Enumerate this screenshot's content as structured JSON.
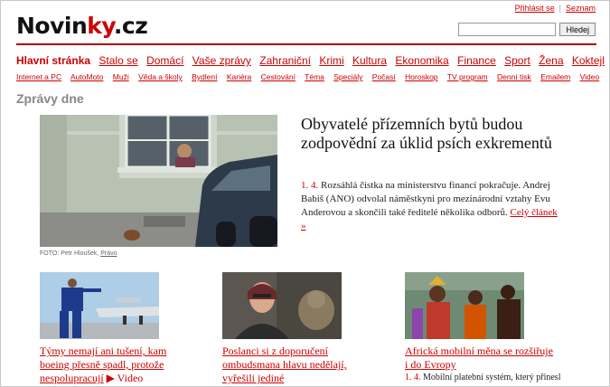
{
  "header": {
    "logo_main": "Novin",
    "logo_accent": "ky",
    "logo_tld": ".cz",
    "login_link": "Přihlásit se",
    "list_link": "Seznam",
    "search_placeholder": "",
    "search_button": "Hledej"
  },
  "nav_primary": [
    "Hlavní stránka",
    "Stalo se",
    "Domácí",
    "Vaše zprávy",
    "Zahraniční",
    "Krimi",
    "Kultura",
    "Ekonomika",
    "Finance",
    "Sport",
    "Žena",
    "Koktejl"
  ],
  "nav_secondary": [
    "Internet a PC",
    "AutoMoto",
    "Muži",
    "Věda a školy",
    "Bydlení",
    "Kariéra",
    "Cestování",
    "Téma",
    "Speciály",
    "Počasí",
    "Horoskop",
    "TV program",
    "Denní tisk",
    "Emailem",
    "Video"
  ],
  "section_title": "Zprávy dne",
  "lead": {
    "headline": "Obyvatelé přízemních bytů budou zodpovědní za úklid psích exkrementů",
    "time": "1. 4.",
    "perex": "Rozsáhlá čistka na ministerstvu financí pokračuje. Andrej Babiš (ANO) odvolal náměstkyni pro mezinárodní vztahy Evu Anderovou a skončili také ředitelé několika odborů.",
    "more_link": "Celý článek »",
    "credit_label": "FOTO: Petr Hloušek,",
    "credit_source": "Právo"
  },
  "cards": [
    {
      "title": "Týmy nemají ani tušení, kam boeing přesně spadl, protože nespolupracují",
      "video_label": "▶ Video"
    },
    {
      "title": "Poslanci si z doporučení ombudsmana hlavu nedělají, vyřešili jediné"
    },
    {
      "title": "Africká mobilní měna se rozšiřuje i do Evropy",
      "time": "1. 4.",
      "sub": "Mobilní platební systém, který přinesl"
    }
  ],
  "colors": {
    "brand_red": "#cc0000",
    "rule": "#aa0000"
  }
}
